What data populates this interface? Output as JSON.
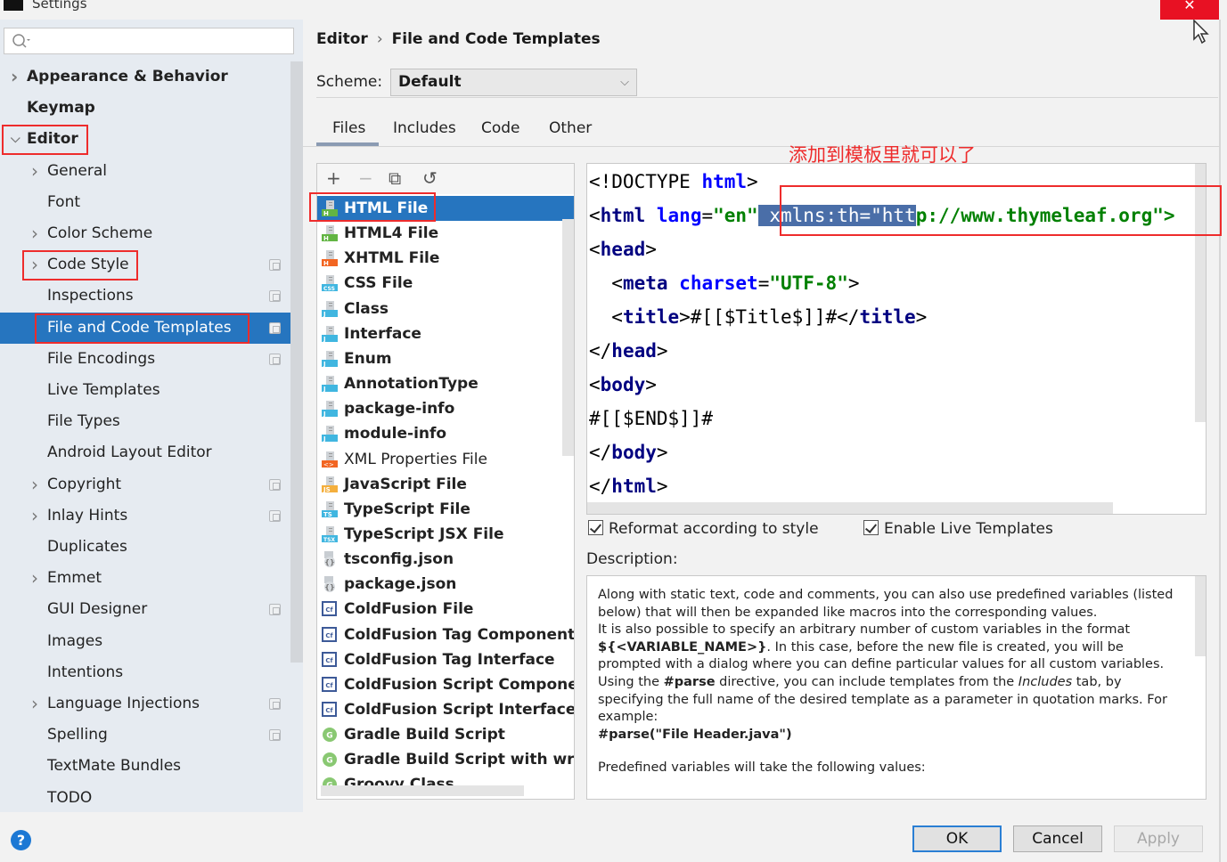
{
  "window": {
    "title": "Settings",
    "close_glyph": "✕"
  },
  "search": {
    "placeholder": "",
    "value": ""
  },
  "sidebar": {
    "items": [
      {
        "label": "Appearance & Behavior",
        "level": 0,
        "expandable": true,
        "expanded": false,
        "bold": true
      },
      {
        "label": "Keymap",
        "level": 0,
        "expandable": false,
        "bold": true
      },
      {
        "label": "Editor",
        "level": 0,
        "expandable": true,
        "expanded": true,
        "bold": true,
        "highlighted": true
      },
      {
        "label": "General",
        "level": 1,
        "expandable": true
      },
      {
        "label": "Font",
        "level": 1
      },
      {
        "label": "Color Scheme",
        "level": 1,
        "expandable": true
      },
      {
        "label": "Code Style",
        "level": 1,
        "expandable": true,
        "project_icon": true,
        "highlighted": true
      },
      {
        "label": "Inspections",
        "level": 1,
        "project_icon": true
      },
      {
        "label": "File and Code Templates",
        "level": 1,
        "project_icon": true,
        "selected": true,
        "highlighted": true
      },
      {
        "label": "File Encodings",
        "level": 1,
        "project_icon": true
      },
      {
        "label": "Live Templates",
        "level": 1
      },
      {
        "label": "File Types",
        "level": 1
      },
      {
        "label": "Android Layout Editor",
        "level": 1
      },
      {
        "label": "Copyright",
        "level": 1,
        "expandable": true,
        "project_icon": true
      },
      {
        "label": "Inlay Hints",
        "level": 1,
        "expandable": true,
        "project_icon": true
      },
      {
        "label": "Duplicates",
        "level": 1
      },
      {
        "label": "Emmet",
        "level": 1,
        "expandable": true
      },
      {
        "label": "GUI Designer",
        "level": 1,
        "project_icon": true
      },
      {
        "label": "Images",
        "level": 1
      },
      {
        "label": "Intentions",
        "level": 1
      },
      {
        "label": "Language Injections",
        "level": 1,
        "expandable": true,
        "project_icon": true
      },
      {
        "label": "Spelling",
        "level": 1,
        "project_icon": true
      },
      {
        "label": "TextMate Bundles",
        "level": 1
      },
      {
        "label": "TODO",
        "level": 1
      }
    ]
  },
  "breadcrumb": {
    "parent": "Editor",
    "separator": "›",
    "current": "File and Code Templates"
  },
  "scheme": {
    "label": "Scheme:",
    "value": "Default"
  },
  "tabs": [
    {
      "label": "Files",
      "active": true
    },
    {
      "label": "Includes"
    },
    {
      "label": "Code"
    },
    {
      "label": "Other"
    }
  ],
  "list_toolbar": {
    "add": "+",
    "remove": "−",
    "copy": "⧉",
    "reset": "↺"
  },
  "templates": [
    {
      "label": "HTML File",
      "icon": "html-file-icon",
      "icon_color": "#62b543",
      "badge": "H",
      "selected": true
    },
    {
      "label": "HTML4 File",
      "icon": "html-file-icon",
      "icon_color": "#62b543",
      "badge": "H"
    },
    {
      "label": "XHTML File",
      "icon": "xhtml-file-icon",
      "icon_color": "#f26522",
      "badge": "H"
    },
    {
      "label": "CSS File",
      "icon": "css-file-icon",
      "icon_color": "#40b6e0",
      "badge": "CSS"
    },
    {
      "label": "Class",
      "icon": "java-file-icon",
      "icon_color": "#40b6e0",
      "badge": "J"
    },
    {
      "label": "Interface",
      "icon": "java-file-icon",
      "icon_color": "#40b6e0",
      "badge": "J"
    },
    {
      "label": "Enum",
      "icon": "java-file-icon",
      "icon_color": "#40b6e0",
      "badge": "J"
    },
    {
      "label": "AnnotationType",
      "icon": "java-file-icon",
      "icon_color": "#40b6e0",
      "badge": "J"
    },
    {
      "label": "package-info",
      "icon": "java-file-icon",
      "icon_color": "#40b6e0",
      "badge": "J"
    },
    {
      "label": "module-info",
      "icon": "java-file-icon",
      "icon_color": "#40b6e0",
      "badge": "J"
    },
    {
      "label": "XML Properties File",
      "icon": "xml-file-icon",
      "icon_color": "#f26522",
      "badge": "<>",
      "normal_weight": true
    },
    {
      "label": "JavaScript File",
      "icon": "js-file-icon",
      "icon_color": "#f4af3d",
      "badge": "JS"
    },
    {
      "label": "TypeScript File",
      "icon": "ts-file-icon",
      "icon_color": "#40b6e0",
      "badge": "TS"
    },
    {
      "label": "TypeScript JSX File",
      "icon": "tsx-file-icon",
      "icon_color": "#40b6e0",
      "badge": "TSX"
    },
    {
      "label": "tsconfig.json",
      "icon": "json-file-icon",
      "icon_color": "#9aa7b0",
      "badge": "{}"
    },
    {
      "label": "package.json",
      "icon": "json-file-icon",
      "icon_color": "#9aa7b0",
      "badge": "{}"
    },
    {
      "label": "ColdFusion File",
      "icon": "coldfusion-icon",
      "icon_color": "#3d5a98",
      "badge": "Cf"
    },
    {
      "label": "ColdFusion Tag Component",
      "icon": "coldfusion-icon",
      "icon_color": "#3d5a98",
      "badge": "Cf"
    },
    {
      "label": "ColdFusion Tag Interface",
      "icon": "coldfusion-icon",
      "icon_color": "#3d5a98",
      "badge": "Cf"
    },
    {
      "label": "ColdFusion Script Component",
      "icon": "coldfusion-icon",
      "icon_color": "#3d5a98",
      "badge": "Cf"
    },
    {
      "label": "ColdFusion Script Interface",
      "icon": "coldfusion-icon",
      "icon_color": "#3d5a98",
      "badge": "Cf"
    },
    {
      "label": "Gradle Build Script",
      "icon": "gradle-icon",
      "icon_color": "#62b543",
      "badge": "G"
    },
    {
      "label": "Gradle Build Script with wrapper",
      "icon": "gradle-icon",
      "icon_color": "#62b543",
      "badge": "G"
    },
    {
      "label": "Groovy Class",
      "icon": "groovy-icon",
      "icon_color": "#62b543",
      "badge": "G"
    }
  ],
  "annotation": "添加到模板里就可以了",
  "editor": {
    "lines": [
      [
        {
          "t": "<!DOCTYPE ",
          "c": ""
        },
        {
          "t": "html",
          "c": "attr"
        },
        {
          "t": ">",
          "c": ""
        }
      ],
      [
        {
          "t": "<",
          "c": ""
        },
        {
          "t": "html",
          "c": "tag"
        },
        {
          "t": " ",
          "c": ""
        },
        {
          "t": "lang",
          "c": "attr"
        },
        {
          "t": "=",
          "c": ""
        },
        {
          "t": "\"en\"",
          "c": "val"
        },
        {
          "t": " xmlns:th=\"htt",
          "c": "sel"
        },
        {
          "t": "p://www.thymeleaf.org\">",
          "c": "val"
        }
      ],
      [
        {
          "t": "<",
          "c": ""
        },
        {
          "t": "head",
          "c": "tag"
        },
        {
          "t": ">",
          "c": ""
        }
      ],
      [
        {
          "t": "  <",
          "c": ""
        },
        {
          "t": "meta",
          "c": "tag"
        },
        {
          "t": " ",
          "c": ""
        },
        {
          "t": "charset",
          "c": "attr"
        },
        {
          "t": "=",
          "c": ""
        },
        {
          "t": "\"UTF-8\"",
          "c": "val"
        },
        {
          "t": ">",
          "c": ""
        }
      ],
      [
        {
          "t": "  <",
          "c": ""
        },
        {
          "t": "title",
          "c": "tag"
        },
        {
          "t": ">#[[$Title$]]#</",
          "c": ""
        },
        {
          "t": "title",
          "c": "tag"
        },
        {
          "t": ">",
          "c": ""
        }
      ],
      [
        {
          "t": "</",
          "c": ""
        },
        {
          "t": "head",
          "c": "tag"
        },
        {
          "t": ">",
          "c": ""
        }
      ],
      [
        {
          "t": "<",
          "c": ""
        },
        {
          "t": "body",
          "c": "tag"
        },
        {
          "t": ">",
          "c": ""
        }
      ],
      [
        {
          "t": "#[[$END$]]#",
          "c": ""
        }
      ],
      [
        {
          "t": "</",
          "c": ""
        },
        {
          "t": "body",
          "c": "tag"
        },
        {
          "t": ">",
          "c": ""
        }
      ],
      [
        {
          "t": "</",
          "c": ""
        },
        {
          "t": "html",
          "c": "tag"
        },
        {
          "t": ">",
          "c": ""
        }
      ]
    ]
  },
  "options": {
    "reformat": {
      "label": "Reformat according to style",
      "checked": true
    },
    "live_templates": {
      "label": "Enable Live Templates",
      "checked": true
    }
  },
  "description": {
    "label": "Description:",
    "paragraphs": [
      [
        {
          "t": "Along with static text, code and comments, you can also use predefined variables (listed below) that will then be expanded like macros into the corresponding values."
        }
      ],
      [
        {
          "t": "It is also possible to specify an arbitrary number of custom variables in the format "
        },
        {
          "t": "${<VARIABLE_NAME>}",
          "b": true
        },
        {
          "t": ". In this case, before the new file is created, you will be prompted with a dialog where you can define particular values for all custom variables."
        }
      ],
      [
        {
          "t": "Using the "
        },
        {
          "t": "#parse",
          "b": true
        },
        {
          "t": " directive, you can include templates from the "
        },
        {
          "t": "Includes",
          "i": true
        },
        {
          "t": " tab, by specifying the full name of the desired template as a parameter in quotation marks. For example:"
        }
      ],
      [
        {
          "t": "#parse(\"File Header.java\")",
          "b": true
        }
      ],
      [
        {
          "t": "Predefined variables will take the following values:"
        }
      ]
    ]
  },
  "buttons": {
    "ok": "OK",
    "cancel": "Cancel",
    "apply": "Apply",
    "help": "?"
  }
}
